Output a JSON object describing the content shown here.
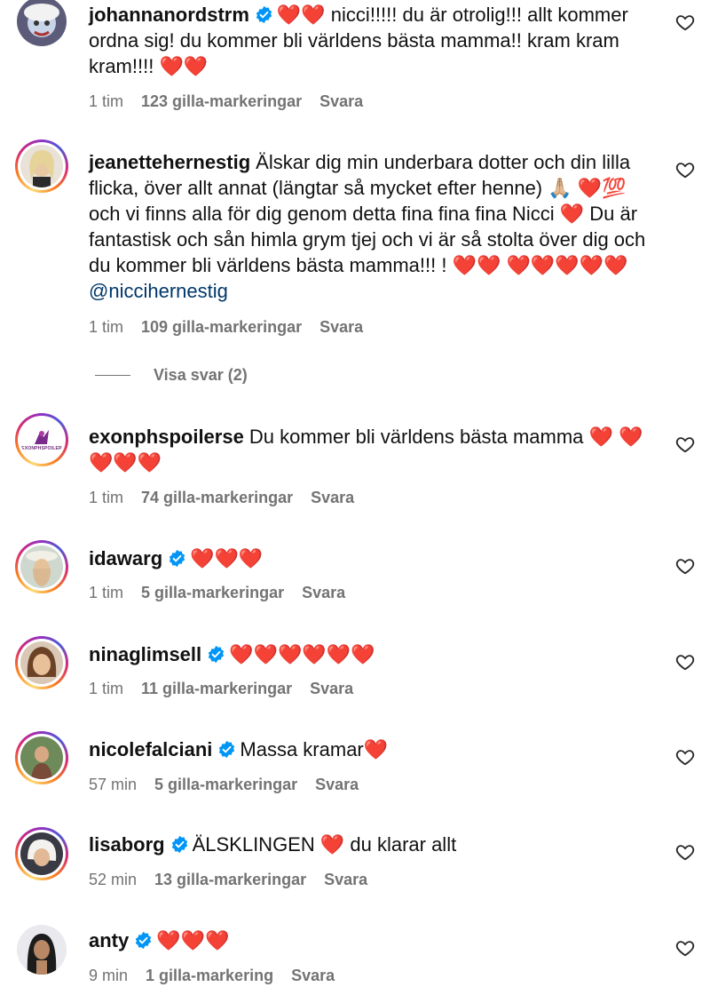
{
  "comments": [
    {
      "username": "johannanordstrm",
      "verified": true,
      "text": "❤️❤️ nicci!!!!! du är otrolig!!! allt kommer ordna sig! du kommer bli världens bästa mamma!! kram kram kram!!!! ❤️❤️",
      "mention": "",
      "time": "1 tim",
      "likes": "123 gilla-markeringar",
      "reply": "Svara"
    },
    {
      "username": "jeanettehernestig",
      "verified": false,
      "text": "Älskar dig min underbara dotter och din lilla flicka, över allt annat (längtar så mycket efter henne) 🙏🏼 ❤️💯 och vi finns alla för dig genom detta fina fina fina Nicci ❤️ Du är fantastisk och sån himla grym tjej och vi är så stolta över dig och du kommer bli världens bästa mamma!!! ! ❤️❤️ ❤️❤️❤️❤️❤️",
      "mention": "@niccihernestig",
      "time": "1 tim",
      "likes": "109 gilla-markeringar",
      "reply": "Svara"
    },
    {
      "username": "exonphspoilerse",
      "verified": false,
      "text": "Du kommer bli världens bästa mamma ❤️ ❤️❤️❤️❤️",
      "mention": "",
      "time": "1 tim",
      "likes": "74 gilla-markeringar",
      "reply": "Svara"
    },
    {
      "username": "idawarg",
      "verified": true,
      "text": "❤️❤️❤️",
      "mention": "",
      "time": "1 tim",
      "likes": "5 gilla-markeringar",
      "reply": "Svara"
    },
    {
      "username": "ninaglimsell",
      "verified": true,
      "text": "❤️❤️❤️❤️❤️❤️",
      "mention": "",
      "time": "1 tim",
      "likes": "11 gilla-markeringar",
      "reply": "Svara"
    },
    {
      "username": "nicolefalciani",
      "verified": true,
      "text": "Massa kramar❤️",
      "mention": "",
      "time": "57 min",
      "likes": "5 gilla-markeringar",
      "reply": "Svara"
    },
    {
      "username": "lisaborg",
      "verified": true,
      "text": "ÄLSKLINGEN ❤️ du klarar allt",
      "mention": "",
      "time": "52 min",
      "likes": "13 gilla-markeringar",
      "reply": "Svara"
    },
    {
      "username": "anty",
      "verified": true,
      "text": "❤️❤️❤️",
      "mention": "",
      "time": "9 min",
      "likes": "1 gilla-markering",
      "reply": "Svara"
    }
  ],
  "view_replies": "Visa svar (2)",
  "avatar_logo_text": "EXONPHSPOILER",
  "colors": {
    "verified": "#0095f6",
    "meta": "#737373",
    "mention": "#00376b",
    "heart": "#e0182d"
  },
  "icons": {
    "like": "heart-outline-icon",
    "verified": "verified-badge-icon"
  }
}
